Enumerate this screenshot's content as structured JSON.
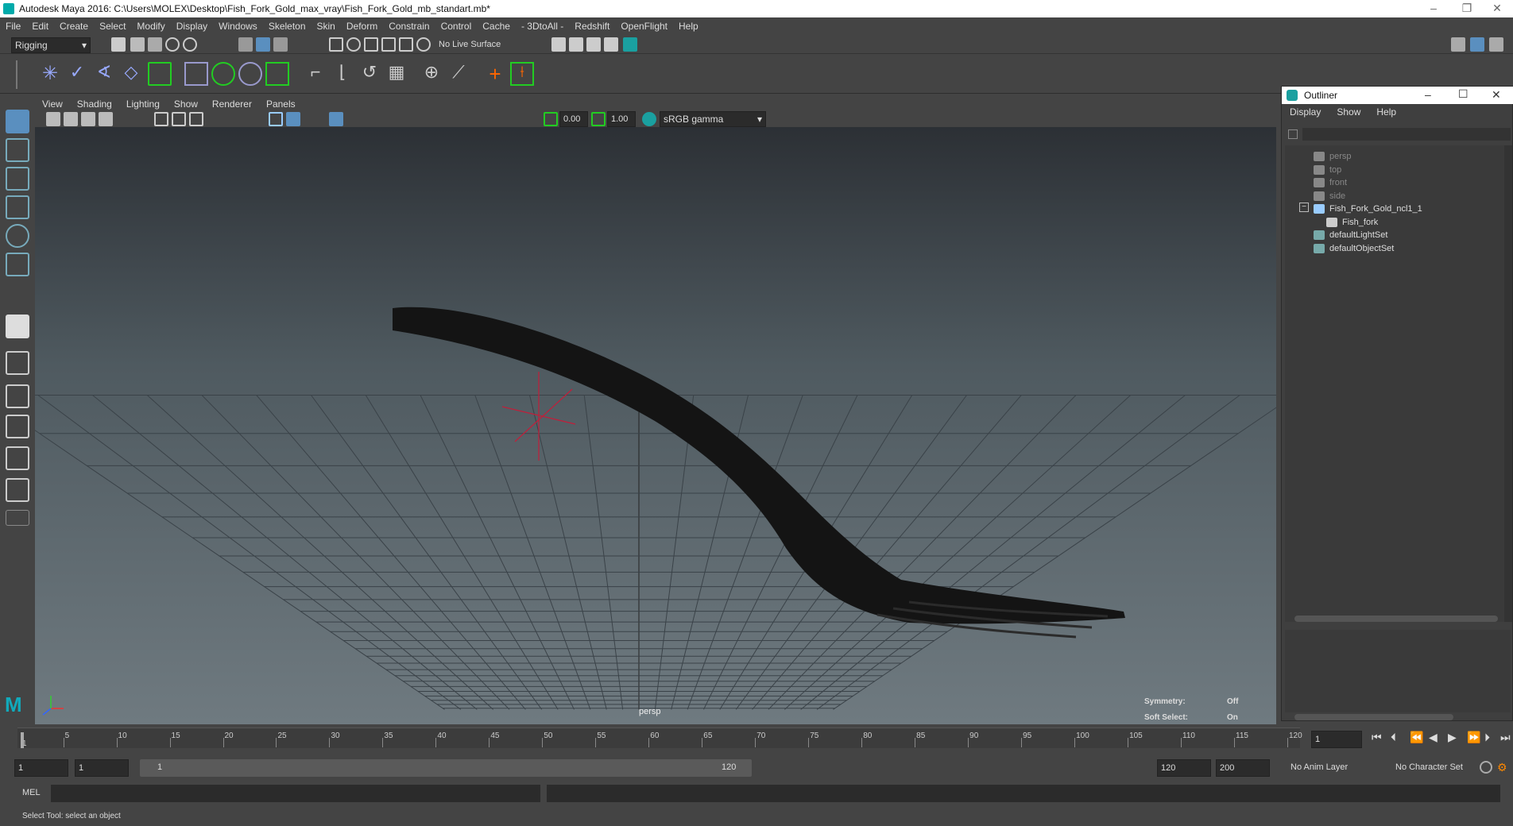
{
  "window": {
    "title": "Autodesk Maya 2016: C:\\Users\\MOLEX\\Desktop\\Fish_Fork_Gold_max_vray\\Fish_Fork_Gold_mb_standart.mb*"
  },
  "menubar": [
    "File",
    "Edit",
    "Create",
    "Select",
    "Modify",
    "Display",
    "Windows",
    "Skeleton",
    "Skin",
    "Deform",
    "Constrain",
    "Control",
    "Cache",
    "- 3DtoAll -",
    "Redshift",
    "OpenFlight",
    "Help"
  ],
  "statusline": {
    "menuset": "Rigging",
    "live_surface": "No Live Surface"
  },
  "viewport": {
    "menu": [
      "View",
      "Shading",
      "Lighting",
      "Show",
      "Renderer",
      "Panels"
    ],
    "exposure": "0.00",
    "gamma": "1.00",
    "colorspace": "sRGB gamma",
    "camera_label": "persp",
    "symmetry_label": "Symmetry:",
    "symmetry_value": "Off",
    "softselect_label": "Soft Select:",
    "softselect_value": "On"
  },
  "outliner": {
    "title": "Outliner",
    "menu": [
      "Display",
      "Show",
      "Help"
    ],
    "items": [
      {
        "label": "persp",
        "dim": true
      },
      {
        "label": "top",
        "dim": true
      },
      {
        "label": "front",
        "dim": true
      },
      {
        "label": "side",
        "dim": true
      },
      {
        "label": "Fish_Fork_Gold_ncl1_1",
        "dim": false
      },
      {
        "label": "Fish_fork",
        "dim": false
      },
      {
        "label": "defaultLightSet",
        "dim": false
      },
      {
        "label": "defaultObjectSet",
        "dim": false
      }
    ]
  },
  "timeslider": {
    "ticks": [
      "1",
      "5",
      "10",
      "15",
      "20",
      "25",
      "30",
      "35",
      "40",
      "45",
      "50",
      "55",
      "60",
      "65",
      "70",
      "75",
      "80",
      "85",
      "90",
      "95",
      "100",
      "105",
      "110",
      "115",
      "120"
    ],
    "current_frame": "1"
  },
  "rangeslider": {
    "start": "1",
    "playback_start": "1",
    "range_start_label": "1",
    "range_end_label": "120",
    "playback_end": "120",
    "end": "200",
    "anim_layer": "No Anim Layer",
    "char_set": "No Character Set"
  },
  "cmdline": {
    "lang": "MEL"
  },
  "helpline": {
    "text": "Select Tool: select an object"
  }
}
